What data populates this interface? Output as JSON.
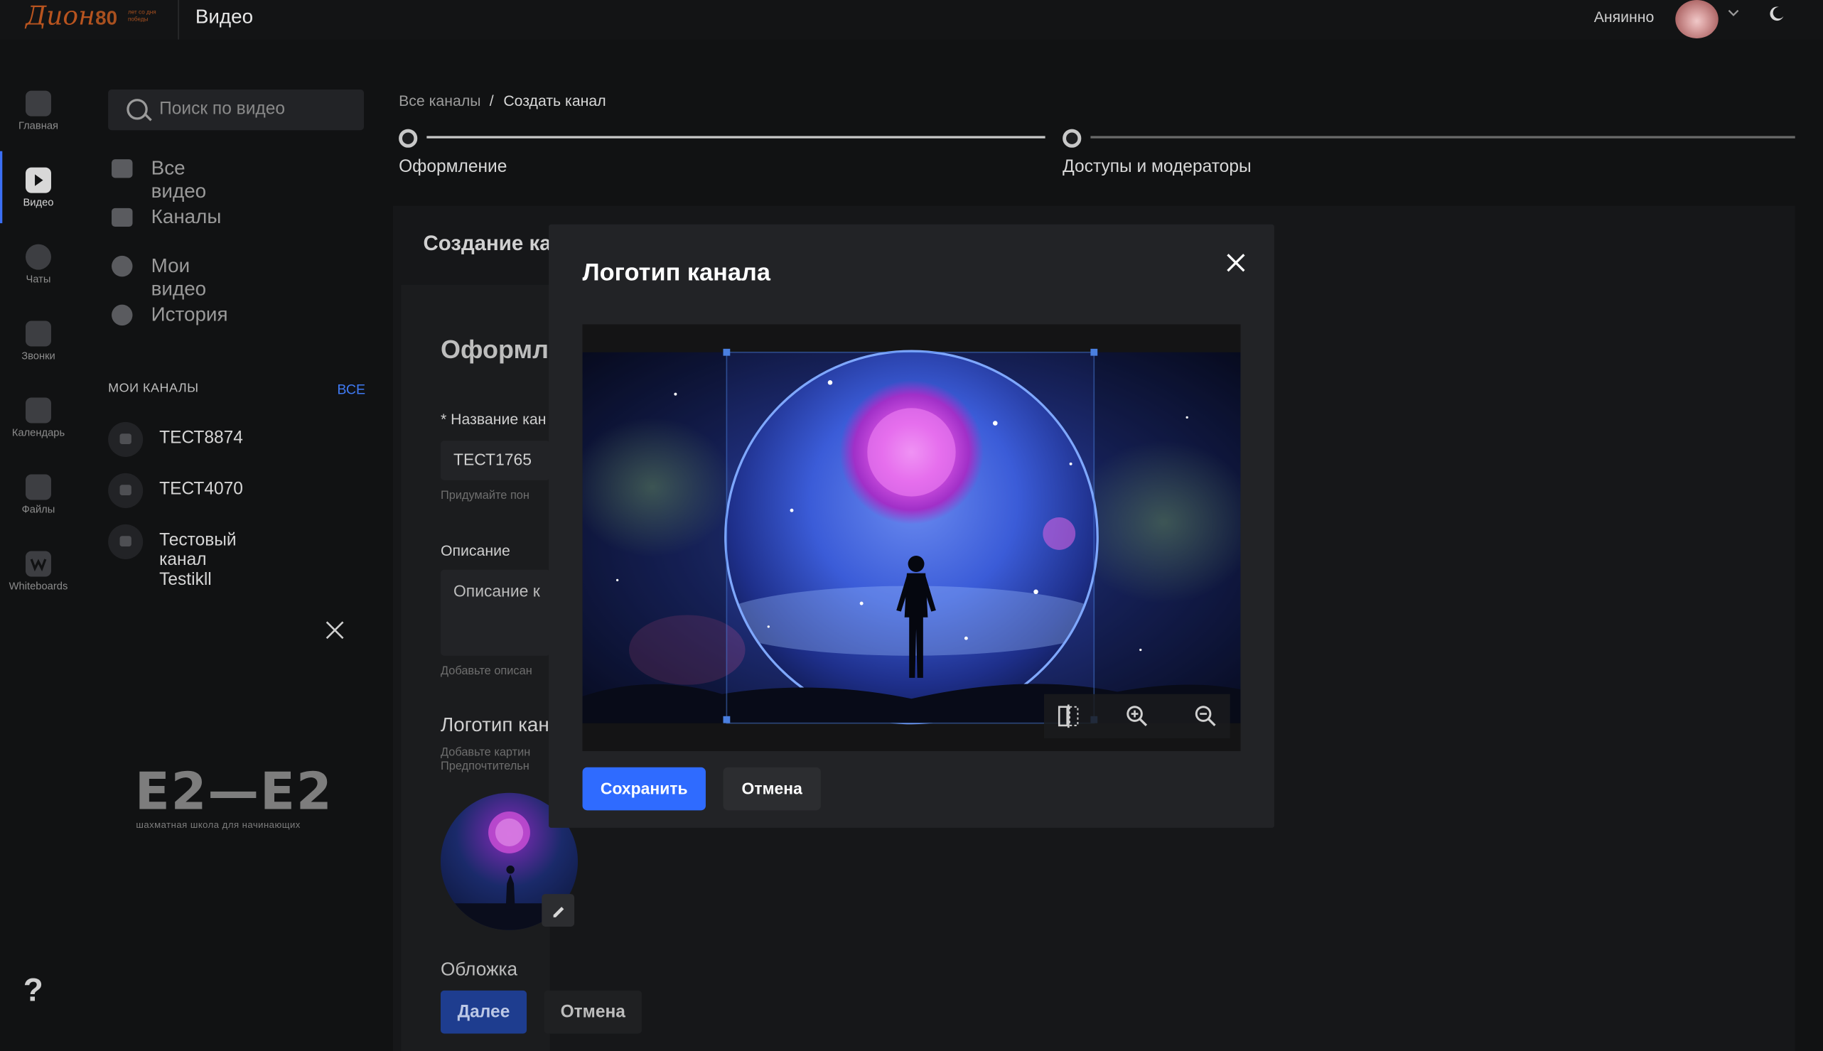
{
  "header": {
    "logo_text": "Дион",
    "logo_number": "80",
    "logo_tagline": "лет со дня победы",
    "section_title": "Видео",
    "username": "Аняинно",
    "avatar_icon": "user-avatar",
    "chevron_icon": "chevron-down-icon",
    "theme_icon": "moon-icon"
  },
  "rail": {
    "items": [
      {
        "label": "Главная",
        "icon": "home-icon"
      },
      {
        "label": "Видео",
        "icon": "play-icon"
      },
      {
        "label": "Чаты",
        "icon": "chat-icon"
      },
      {
        "label": "Звонки",
        "icon": "phone-icon"
      },
      {
        "label": "Календарь",
        "icon": "calendar-icon"
      },
      {
        "label": "Файлы",
        "icon": "files-icon"
      },
      {
        "label": "Whiteboards",
        "icon": "whiteboard-icon"
      }
    ],
    "help": "?"
  },
  "sidebar": {
    "search_placeholder": "Поиск по видео",
    "nav": [
      {
        "label": "Все видео",
        "icon": "video-icon"
      },
      {
        "label": "Каналы",
        "icon": "tv-icon"
      },
      {
        "label": "Мои видео",
        "icon": "record-icon"
      },
      {
        "label": "История",
        "icon": "clock-icon"
      }
    ],
    "my_channels_title": "МОИ КАНАЛЫ",
    "my_channels_all": "ВСЕ",
    "channels": [
      "ТЕСТ8874",
      "ТЕСТ4070",
      "Тестовый канал Testikll"
    ],
    "promo_logo": "E2—E2",
    "promo_subtitle": "шахматная школа для начинающих"
  },
  "content": {
    "breadcrumb": {
      "parent": "Все каналы",
      "separator": "/",
      "current": "Создать канал"
    },
    "steps": [
      {
        "label": "Оформление"
      },
      {
        "label": "Доступы и модераторы"
      }
    ],
    "page_title": "Создание ка",
    "form_title": "Оформле",
    "name_label": "* Название кан",
    "name_value": "ТЕСТ1765",
    "name_hint": "Придумайте пон",
    "desc_label": "Описание",
    "desc_placeholder": "Описание к",
    "desc_hint": "Добавьте описан",
    "logo_title": "Логотип кан",
    "logo_hint_1": "Добавьте картин",
    "logo_hint_2": "Предпочтительн",
    "cover_title": "Обложка",
    "next_button": "Далее",
    "cancel_button": "Отмена"
  },
  "modal": {
    "title": "Логотип канала",
    "save_button": "Сохранить",
    "cancel_button": "Отмена",
    "tools": [
      {
        "icon": "flip-horizontal-icon"
      },
      {
        "icon": "zoom-in-icon"
      },
      {
        "icon": "zoom-out-icon"
      }
    ]
  },
  "colors": {
    "accent": "#2f6bff",
    "background": "#111213",
    "modal_bg": "#222326",
    "link": "#3f79f2",
    "logo_orange": "#b8541f"
  }
}
